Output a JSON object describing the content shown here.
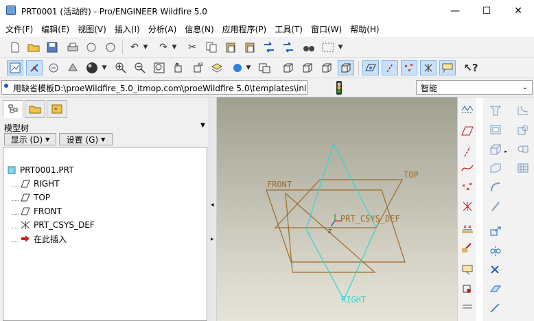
{
  "window": {
    "title": "PRT0001 (活动的) - Pro/ENGINEER Wildfire 5.0",
    "minimize_glyph": "—",
    "maximize_glyph": "☐",
    "close_glyph": "✕"
  },
  "menu": [
    "文件(F)",
    "编辑(E)",
    "视图(V)",
    "插入(I)",
    "分析(A)",
    "信息(N)",
    "应用程序(P)",
    "工具(T)",
    "窗口(W)",
    "帮助(H)"
  ],
  "message_bar": {
    "text": "用缺省模板D:\\proeWildfire_5.0_itmop.com\\proeWildfire 5.0\\templates\\inlbs",
    "filter_value": "智能"
  },
  "panel": {
    "header": "模型树",
    "display_button": "显示 (D)",
    "settings_button": "设置 (G)"
  },
  "tree": [
    {
      "label": "PRT0001.PRT",
      "icon": "part-icon"
    },
    {
      "label": "RIGHT",
      "icon": "datum-plane-icon"
    },
    {
      "label": "TOP",
      "icon": "datum-plane-icon"
    },
    {
      "label": "FRONT",
      "icon": "datum-plane-icon"
    },
    {
      "label": "PRT_CSYS_DEF",
      "icon": "csys-icon"
    },
    {
      "label": "在此插入",
      "icon": "insert-arrow-icon"
    }
  ],
  "viewport": {
    "plane_front": "FRONT",
    "plane_top": "TOP",
    "plane_right": "RIGHT",
    "csys": "PRT_CSYS_DEF",
    "colors": {
      "datum_brown": "#9a6a2a",
      "datum_cyan": "#3cd2d2",
      "csys_red": "#e02020",
      "csys_green": "#20a020"
    }
  },
  "colors": {
    "accent": "#1a5cc8",
    "active_toggle": "#c9e0f7"
  }
}
